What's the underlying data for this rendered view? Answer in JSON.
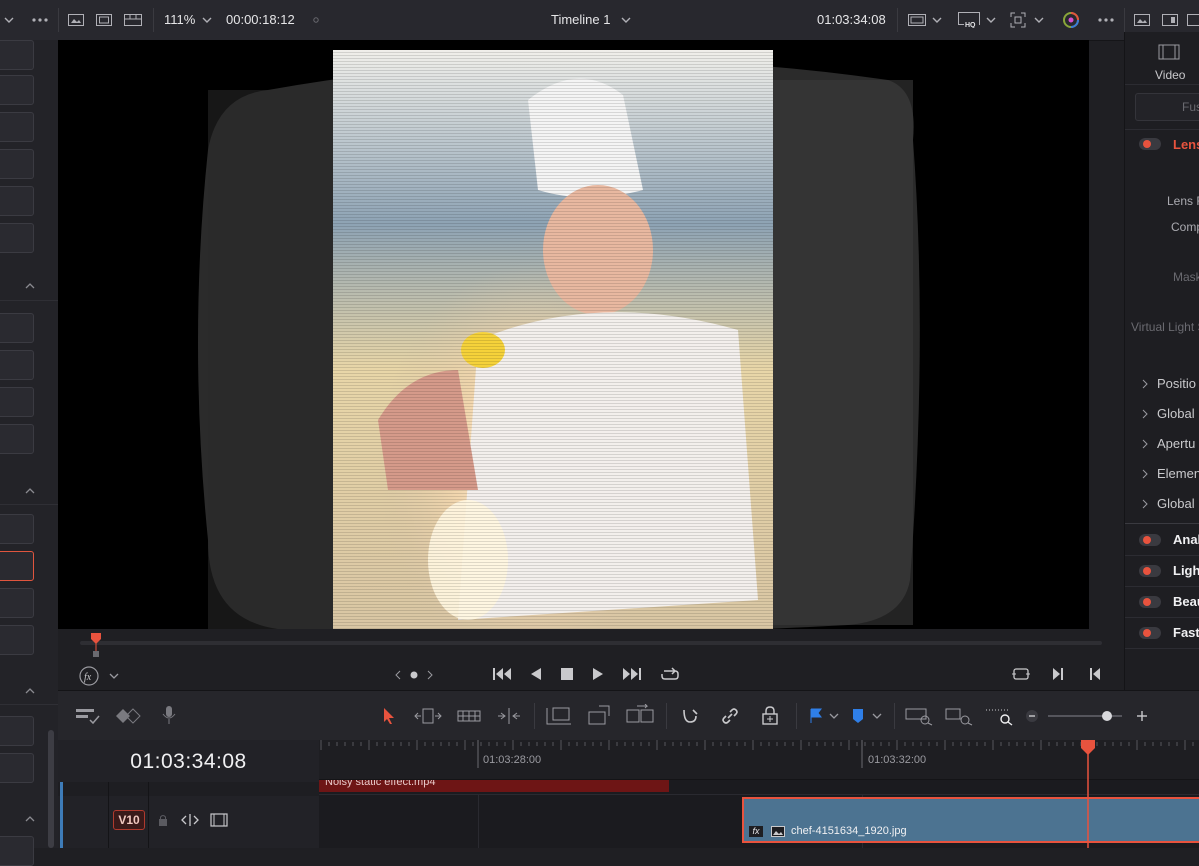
{
  "topbar": {
    "zoom": "111%",
    "source_timecode": "00:00:18:12",
    "timeline_name": "Timeline 1",
    "record_timecode": "01:03:34:08",
    "hq_badge": "HQ"
  },
  "viewer": {
    "image_description_icon": "video-frame",
    "playhead_progress": 0.03
  },
  "inspector": {
    "tab_video": "Video",
    "search_placeholder": "Fus",
    "lens_section": "Lens",
    "labels": [
      "Lens F",
      "Comp",
      "Mask",
      "Virtual Light S"
    ],
    "groups": [
      "Positio",
      "Global",
      "Apertu",
      "Elemen",
      "Global"
    ],
    "effects": [
      "Anal",
      "Ligh",
      "Beau",
      "Fast"
    ]
  },
  "timeline": {
    "timecode": "01:03:34:08",
    "ruler_marks": [
      "01:03:28:00",
      "01:03:32:00"
    ],
    "track_label": "V10",
    "clip_upper_name": "Noisy static effect.mp4",
    "clip_name": "chef-4151634_1920.jpg",
    "fx_badge": "fx"
  },
  "colors": {
    "accent_red": "#e8533e",
    "clip_blue": "#4c7391",
    "clip_red": "#6e1515",
    "playhead": "#e8533e"
  }
}
